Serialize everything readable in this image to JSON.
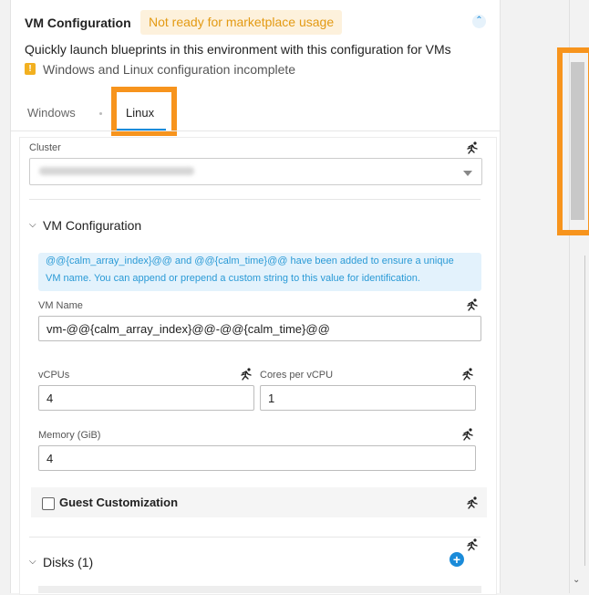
{
  "header": {
    "title": "VM Configuration",
    "badge": "Not ready for marketplace usage",
    "collapse_icon": "chevron-up-icon"
  },
  "description": "Quickly launch blueprints in this environment with this configuration for VMs",
  "warning": {
    "icon": "!",
    "text": "Windows and Linux configuration incomplete"
  },
  "tabs": [
    {
      "label": "Windows",
      "active": false
    },
    {
      "label": "Linux",
      "active": true
    }
  ],
  "cluster": {
    "label": "Cluster",
    "value": "cluster-1800-subpolo.soh.int"
  },
  "vm_config": {
    "title": "VM Configuration",
    "info_line1": "@@{calm_array_index}@@ and @@{calm_time}@@ have been added to ensure a unique",
    "info_line2": "VM name. You can append or prepend a custom string to this value for identification.",
    "vm_name_label": "VM Name",
    "vm_name_value": "vm-@@{calm_array_index}@@-@@{calm_time}@@",
    "vcpus_label": "vCPUs",
    "vcpus_value": "4",
    "cores_label": "Cores per vCPU",
    "cores_value": "1",
    "memory_label": "Memory (GiB)",
    "memory_value": "4",
    "guest_label": "Guest Customization"
  },
  "disks": {
    "title": "Disks (1)",
    "add_symbol": "+"
  },
  "colors": {
    "accent": "#1a8bd9",
    "warning": "#e39a13",
    "highlight": "#f7941d"
  }
}
